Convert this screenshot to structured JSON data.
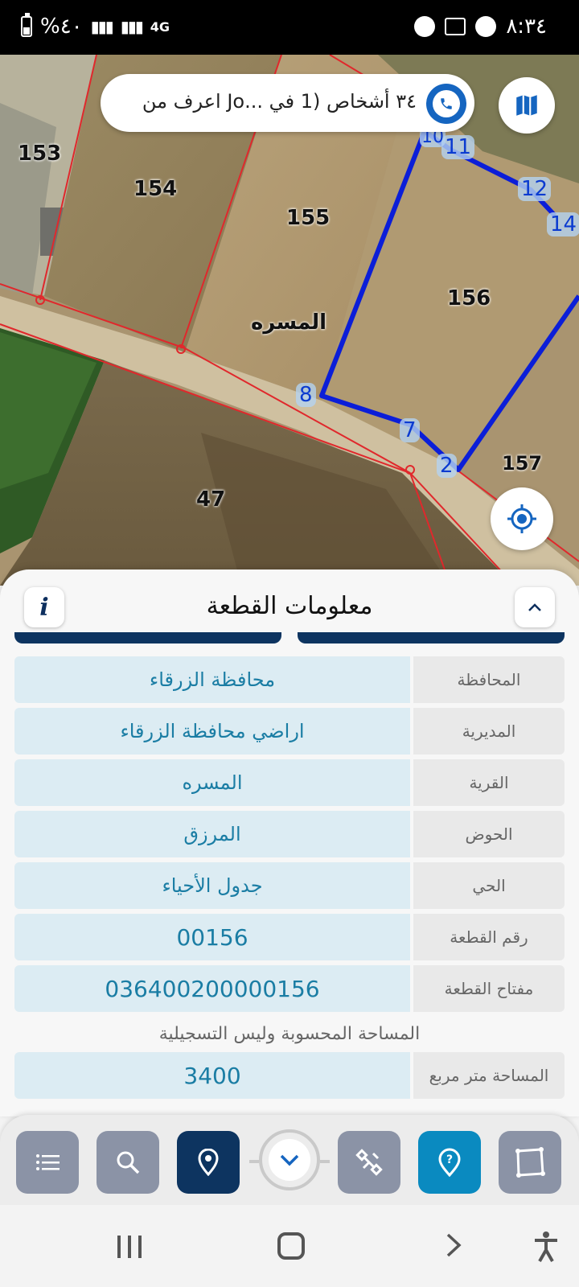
{
  "status_bar": {
    "time": "٨:٣٤",
    "battery": "%٤٠",
    "network": "4G"
  },
  "search": {
    "text": "٣٤ أشخاص (1 في ...Jo  اعرف من"
  },
  "map": {
    "parcels": [
      "153",
      "154",
      "155",
      "156",
      "157",
      "47"
    ],
    "village_label": "المسره",
    "vertices": [
      "8",
      "7",
      "2",
      "11",
      "12",
      "14",
      "10"
    ]
  },
  "panel": {
    "title": "معلومات القطعة",
    "info_icon": "i",
    "collapse_icon": "˄",
    "rows": [
      {
        "label": "المحافظة",
        "value": "محافظة الزرقاء"
      },
      {
        "label": "المديرية",
        "value": "اراضي محافظة الزرقاء"
      },
      {
        "label": "القرية",
        "value": "المسره"
      },
      {
        "label": "الحوض",
        "value": "المرزق"
      },
      {
        "label": "الحي",
        "value": "جدول الأحياء"
      },
      {
        "label": "رقم القطعة",
        "value": "00156"
      },
      {
        "label": "مفتاح القطعة",
        "value": "036400200000156"
      }
    ],
    "area_section_title": "المساحة المحسوبة وليس التسجيلية",
    "area_row": {
      "label": "المساحة متر مربع",
      "value": "3400"
    }
  },
  "toolbar": {
    "buttons": [
      "list-icon",
      "search-icon",
      "location-pin-icon",
      "chevron-down-icon",
      "satellite-icon",
      "help-icon",
      "polygon-icon"
    ]
  },
  "colors": {
    "navy": "#0d3460",
    "teal": "#0a8ac0",
    "value_text": "#1a7da4",
    "value_bg": "#dcecf3",
    "parcel_blue": "#0b1ed8",
    "parcel_red": "#e0282c"
  }
}
